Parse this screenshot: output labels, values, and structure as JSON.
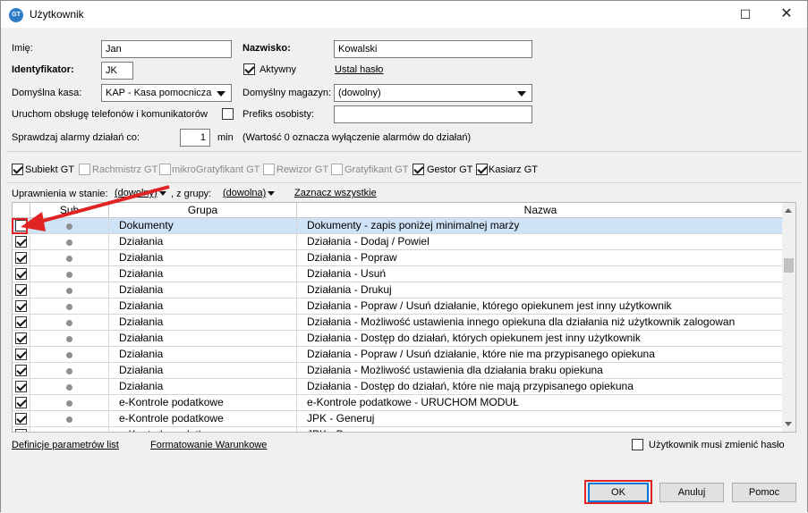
{
  "window": {
    "title": "Użytkownik",
    "icon_text": "GT",
    "maximize_glyph": "☐",
    "close_glyph": "✕"
  },
  "form": {
    "imie_label": "Imię:",
    "imie_value": "Jan",
    "nazwisko_label": "Nazwisko:",
    "nazwisko_value": "Kowalski",
    "identyfikator_label": "Identyfikator:",
    "identyfikator_value": "JK",
    "aktywny_label": "Aktywny",
    "aktywny_checked": true,
    "ustal_haslo_label": "Ustal hasło",
    "kasa_label": "Domyślna kasa:",
    "kasa_value": "KAP - Kasa pomocnicza",
    "magazyn_label": "Domyślny magazyn:",
    "magazyn_value": "(dowolny)",
    "telefony_label": "Uruchom obsługę telefonów i komunikatorów",
    "prefiks_label": "Prefiks osobisty:",
    "prefiks_value": "",
    "alarmy_label": "Sprawdzaj alarmy działań co:",
    "alarmy_value": "1",
    "alarmy_unit": "min",
    "alarmy_note": "(Wartość 0 oznacza wyłączenie alarmów do działań)"
  },
  "modules": [
    {
      "label": "Subiekt GT",
      "checked": true,
      "enabled": true
    },
    {
      "label": "Rachmistrz GT",
      "checked": false,
      "enabled": false
    },
    {
      "label": "mikroGratyfikant GT",
      "checked": false,
      "enabled": false
    },
    {
      "label": "Rewizor GT",
      "checked": false,
      "enabled": false
    },
    {
      "label": "Gratyfikant GT",
      "checked": false,
      "enabled": false
    },
    {
      "label": "Gestor GT",
      "checked": true,
      "enabled": true
    },
    {
      "label": "Kasiarz GT",
      "checked": true,
      "enabled": true
    }
  ],
  "filter": {
    "stan_label": "Uprawnienia w stanie:",
    "stan_value": "(dowolny)",
    "grupa_label": ", z grupy:",
    "grupa_value": "(dowolna)",
    "zaznacz_label": "Zaznacz wszystkie"
  },
  "table": {
    "headers": {
      "sub": "Sub",
      "grupa": "Grupa",
      "nazwa": "Nazwa"
    },
    "rows": [
      {
        "checked": false,
        "grupa": "Dokumenty",
        "nazwa": "Dokumenty - zapis poniżej minimalnej marży"
      },
      {
        "checked": true,
        "grupa": "Działania",
        "nazwa": "Działania - Dodaj / Powiel"
      },
      {
        "checked": true,
        "grupa": "Działania",
        "nazwa": "Działania - Popraw"
      },
      {
        "checked": true,
        "grupa": "Działania",
        "nazwa": "Działania - Usuń"
      },
      {
        "checked": true,
        "grupa": "Działania",
        "nazwa": "Działania - Drukuj"
      },
      {
        "checked": true,
        "grupa": "Działania",
        "nazwa": "Działania - Popraw / Usuń działanie, którego opiekunem jest inny użytkownik"
      },
      {
        "checked": true,
        "grupa": "Działania",
        "nazwa": "Działania - Możliwość ustawienia innego opiekuna dla działania niż użytkownik zalogowan"
      },
      {
        "checked": true,
        "grupa": "Działania",
        "nazwa": "Działania - Dostęp do działań, których opiekunem jest inny użytkownik"
      },
      {
        "checked": true,
        "grupa": "Działania",
        "nazwa": "Działania - Popraw / Usuń działanie, które nie ma przypisanego opiekuna"
      },
      {
        "checked": true,
        "grupa": "Działania",
        "nazwa": "Działania - Możliwość ustawienia dla działania braku opiekuna"
      },
      {
        "checked": true,
        "grupa": "Działania",
        "nazwa": "Działania - Dostęp do działań, które nie mają przypisanego opiekuna"
      },
      {
        "checked": true,
        "grupa": "e-Kontrole podatkowe",
        "nazwa": "e-Kontrole podatkowe - URUCHOM MODUŁ"
      },
      {
        "checked": true,
        "grupa": "e-Kontrole podatkowe",
        "nazwa": "JPK - Generuj"
      },
      {
        "checked": true,
        "grupa": "e-Kontrole podatkowe",
        "nazwa": "JPK - Przeg"
      }
    ]
  },
  "footer": {
    "definicje_label": "Definicje parametrów list",
    "formatowanie_label": "Formatowanie Warunkowe",
    "zmien_haslo_label": "Użytkownik musi zmienić hasło"
  },
  "buttons": {
    "ok": "OK",
    "anuluj": "Anuluj",
    "pomoc": "Pomoc"
  },
  "colors": {
    "annotation": "#e02424",
    "selected_row": "#cfe3f6"
  }
}
